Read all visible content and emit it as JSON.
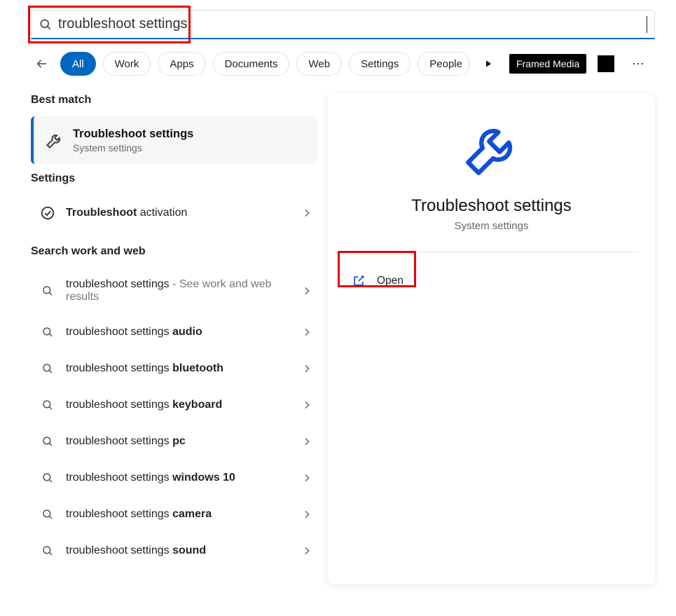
{
  "search": {
    "value": "troubleshoot settings"
  },
  "tabs": {
    "all": "All",
    "work": "Work",
    "apps": "Apps",
    "documents": "Documents",
    "web": "Web",
    "settings": "Settings",
    "people": "People"
  },
  "tag": {
    "framed": "Framed Media"
  },
  "sections": {
    "best_match": "Best match",
    "settings": "Settings",
    "sww": "Search work and web"
  },
  "best_match": {
    "title": "Troubleshoot settings",
    "sub": "System settings"
  },
  "settings_row": {
    "bold": "Troubleshoot",
    "rest": " activation"
  },
  "sww_rows": [
    {
      "prefix": "troubleshoot settings",
      "bold": "",
      "hint": " - See work and web results",
      "multiline": true
    },
    {
      "prefix": "troubleshoot settings ",
      "bold": "audio",
      "hint": ""
    },
    {
      "prefix": "troubleshoot settings ",
      "bold": "bluetooth",
      "hint": ""
    },
    {
      "prefix": "troubleshoot settings ",
      "bold": "keyboard",
      "hint": ""
    },
    {
      "prefix": "troubleshoot settings ",
      "bold": "pc",
      "hint": ""
    },
    {
      "prefix": "troubleshoot settings ",
      "bold": "windows 10",
      "hint": ""
    },
    {
      "prefix": "troubleshoot settings ",
      "bold": "camera",
      "hint": ""
    },
    {
      "prefix": "troubleshoot settings ",
      "bold": "sound",
      "hint": ""
    }
  ],
  "detail": {
    "title": "Troubleshoot settings",
    "sub": "System settings",
    "open": "Open"
  }
}
